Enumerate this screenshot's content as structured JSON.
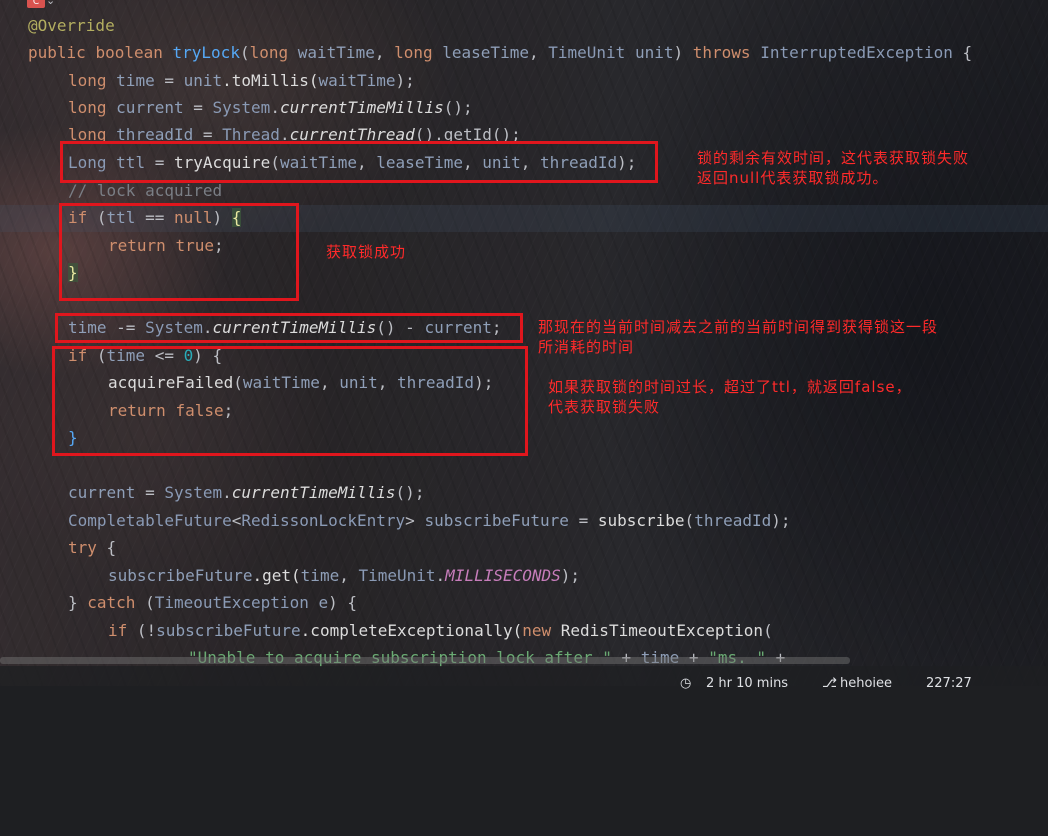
{
  "editor": {
    "gutter_icon": "class-icon",
    "annotation": "@Override",
    "sig": {
      "kw1": "public",
      "kw2": "boolean",
      "name": "tryLock",
      "open": "(",
      "t1": "long",
      "p1": "waitTime",
      "sep1": ", ",
      "t2": "long",
      "p2": "leaseTime",
      "sep2": ", ",
      "t3": "TimeUnit",
      "p3": "unit",
      "close": ")",
      "throws": "throws",
      "exc": "InterruptedException",
      "brace": "{"
    },
    "l3": {
      "kw": "long",
      "v": "time",
      "eq": " = ",
      "obj": "unit",
      "call": ".toMillis(",
      "arg": "waitTime",
      "end": ");"
    },
    "l4": {
      "kw": "long",
      "v": "current",
      "eq": " = ",
      "cls": "System",
      "dot": ".",
      "m": "currentTimeMillis",
      "end": "();"
    },
    "l5": {
      "kw": "long",
      "v": "threadId",
      "eq": " = ",
      "cls": "Thread",
      "dot": ".",
      "m": "currentThread",
      "end": "().getId();"
    },
    "l6": {
      "type": "Long",
      "v": "ttl",
      "eq": " = ",
      "m": "tryAcquire",
      "open": "(",
      "a1": "waitTime",
      "c1": ", ",
      "a2": "leaseTime",
      "c2": ", ",
      "a3": "unit",
      "c3": ", ",
      "a4": "threadId",
      "end": ");"
    },
    "l7": "// lock acquired",
    "l8": {
      "kw": "if",
      "open": " (",
      "v": "ttl",
      "op": " == ",
      "nul": "null",
      "close": ") ",
      "brace": "{"
    },
    "l9": {
      "kw": "return",
      "val": "true",
      "end": ";"
    },
    "l10": "}",
    "l11": {
      "v": "time",
      "op": " -= ",
      "cls": "System",
      "dot": ".",
      "m": "currentTimeMillis",
      "mid": "() - ",
      "v2": "current",
      "end": ";"
    },
    "l12": {
      "kw": "if",
      "open": " (",
      "v": "time",
      "op": " <= ",
      "num": "0",
      "close": ") ",
      "brace": "{"
    },
    "l13": {
      "m": "acquireFailed",
      "open": "(",
      "a1": "waitTime",
      "c1": ", ",
      "a2": "unit",
      "c2": ", ",
      "a3": "threadId",
      "end": ");"
    },
    "l14": {
      "kw": "return",
      "val": "false",
      "end": ";"
    },
    "l15": "}",
    "l16": {
      "v": "current",
      "eq": " = ",
      "cls": "System",
      "dot": ".",
      "m": "currentTimeMillis",
      "end": "();"
    },
    "l17": {
      "cls": "CompletableFuture",
      "lt": "<",
      "cls2": "RedissonLockEntry",
      "gt": "> ",
      "v": "subscribeFuture",
      "eq": " = ",
      "m": "subscribe",
      "open": "(",
      "a": "threadId",
      "end": ");"
    },
    "l18": {
      "kw": "try",
      "brace": " {"
    },
    "l19": {
      "v": "subscribeFuture",
      "m": ".get(",
      "a": "time",
      "c": ", ",
      "cls": "TimeUnit",
      "dot": ".",
      "const": "MILLISECONDS",
      "end": ");"
    },
    "l20": {
      "close": "} ",
      "kw": "catch",
      "open": " (",
      "cls": "TimeoutException",
      "v": " e",
      "end": ") {"
    },
    "l21": {
      "kw": "if",
      "open": " (!",
      "v": "subscribeFuture",
      "m": ".completeExceptionally(",
      "kw2": "new",
      "cls": " RedisTimeoutException",
      "end": "("
    },
    "l22": {
      "str": "\"Unable to acquire subscription lock after \"",
      "op1": " + ",
      "v": "time",
      "op2": " + ",
      "str2": "\"ms. \"",
      "op3": " +"
    }
  },
  "notes": {
    "n1_line1": "锁的剩余有效时间，这代表获取锁失败",
    "n1_line2": "返回null代表获取锁成功。",
    "n2": "获取锁成功",
    "n3_line1": "那现在的当前时间减去之前的当前时间得到获得锁这一段",
    "n3_line2": "所消耗的时间",
    "n4_line1": "如果获取锁的时间过长，超过了ttl，就返回false，",
    "n4_line2": "代表获取锁失败"
  },
  "statusbar": {
    "clock_icon": "clock-icon",
    "time_spent": "2 hr 10 mins",
    "branch_icon": "git-branch-icon",
    "branch": "hehoiee",
    "position": "227:27"
  }
}
